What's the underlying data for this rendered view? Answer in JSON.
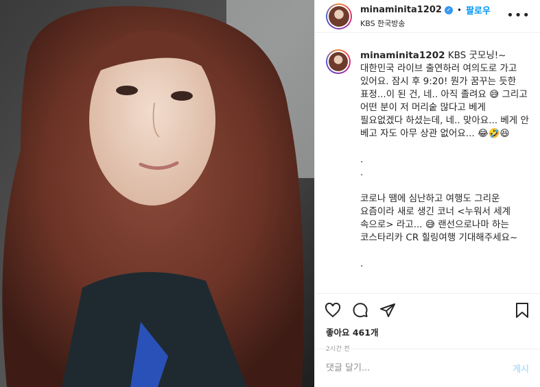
{
  "header": {
    "username": "minaminita1202",
    "separator": "•",
    "follow_label": "팔로우",
    "location": "KBS 한국방송",
    "more_icon": "more-horizontal-icon"
  },
  "caption": {
    "username": "minaminita1202",
    "text": " KBS 굿모닝!~ 대한민국 라이브 출연하러 여의도로 가고 있어요. 잠시 후 9:20! 뭔가 꿈꾸는 듯한 표정...이 된 건, 네.. 아직 졸려요 😅 그리고 어떤 분이 저 머리숱 많다고 베게 필요없겠다 하셨는데, 네.. 맞아요... 베게 안 베고 자도 아무 상관 없어요... 😂🤣😆\n\n.\n.\n\n코로나 땜에 심난하고 여행도 그리운 요즘이라 새로 생긴 코너 <누워서 세계 속으로> 라고... 😅 랜선으로나마 하는 코스타리카 CR 힐링여행 기대해주세요~\n\n."
  },
  "actions": {
    "like_icon": "heart-icon",
    "comment_icon": "comment-icon",
    "share_icon": "share-icon",
    "save_icon": "bookmark-icon",
    "likes_label": "좋아요 461개",
    "time_ago": "2시간 전"
  },
  "comment_input": {
    "placeholder": "댓글 달기...",
    "post_label": "게시"
  },
  "colors": {
    "accent": "#0095f6",
    "verified": "#3897f0",
    "post_disabled": "#b2dffc"
  }
}
